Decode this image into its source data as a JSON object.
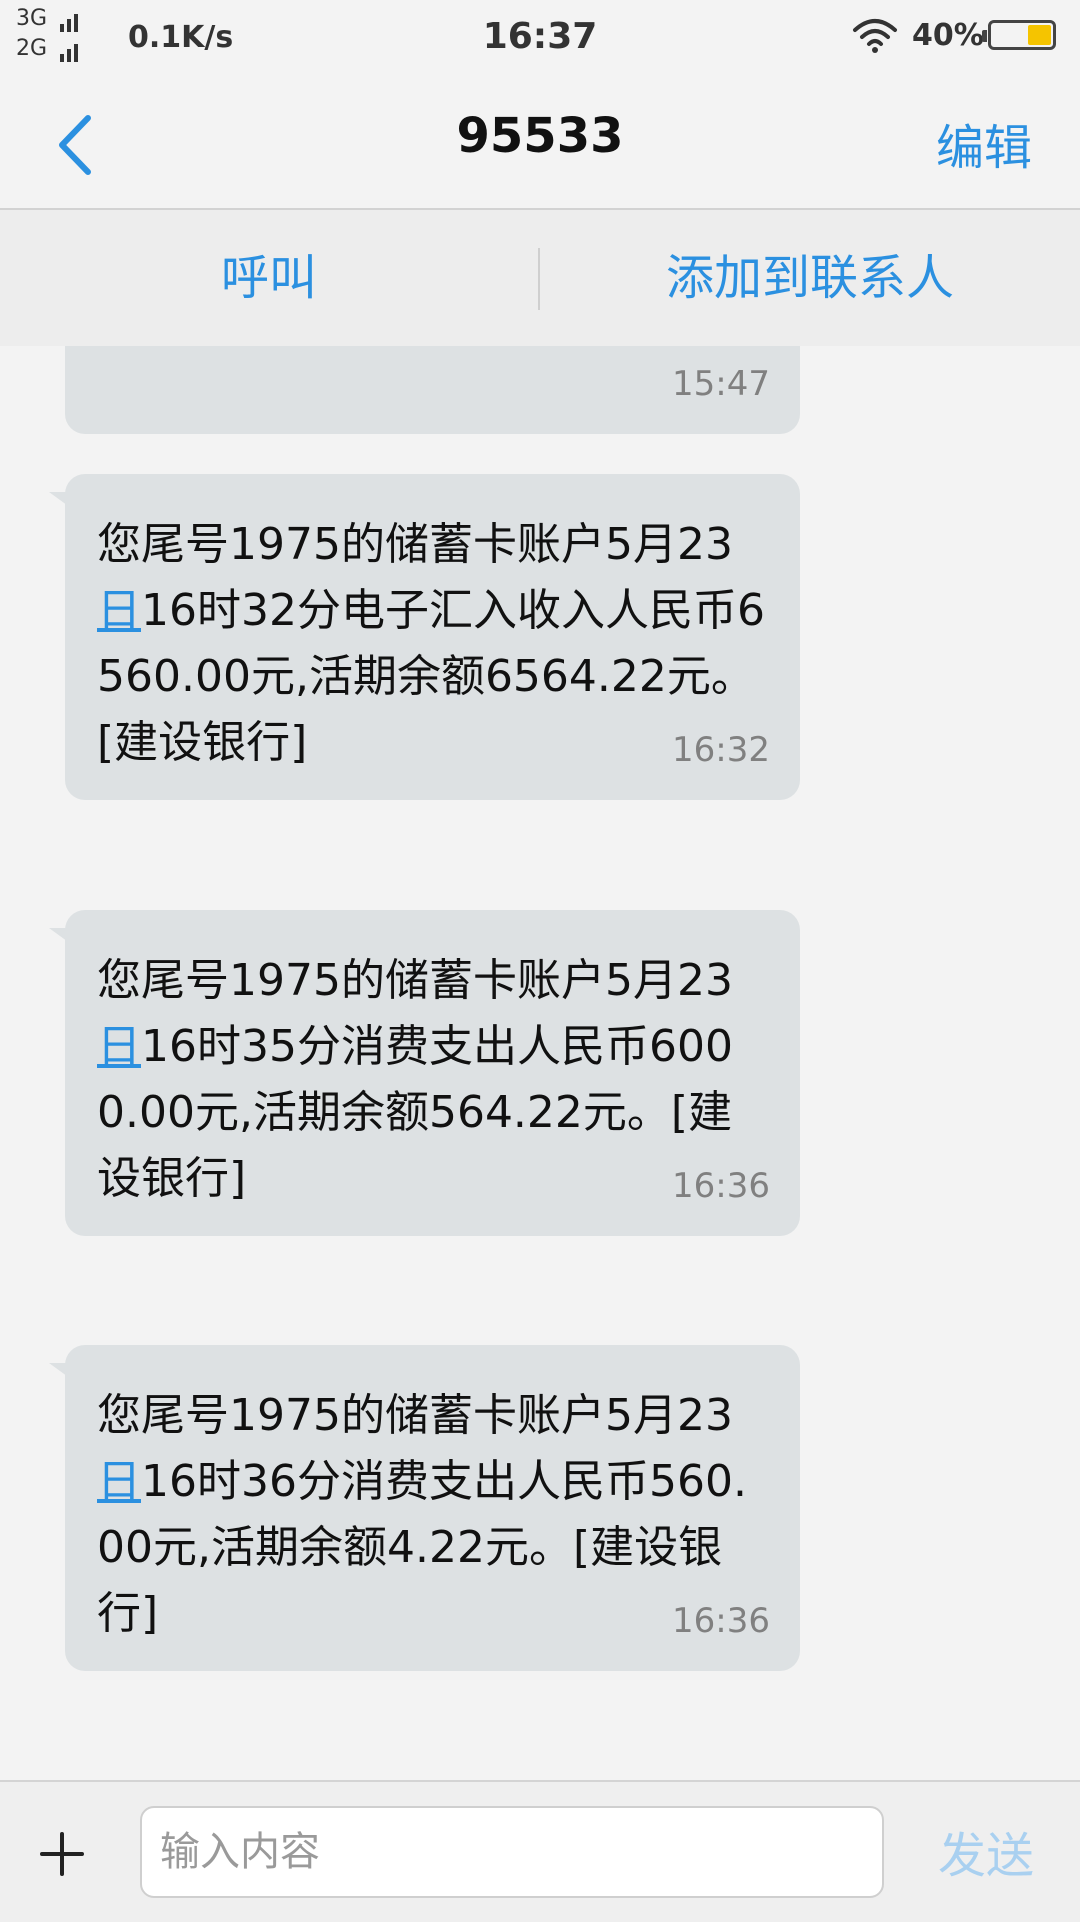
{
  "status_bar": {
    "network_top": "3G",
    "network_bottom": "2G",
    "speed": "0.1K/s",
    "time": "16:37",
    "battery_percent": "40%",
    "battery_level": 0.4,
    "battery_color": "#f5c400"
  },
  "nav": {
    "back_icon": "chevron-left-icon",
    "title": "95533",
    "edit_label": "编辑"
  },
  "actions": {
    "call_label": "呼叫",
    "add_contact_label": "添加到联系人"
  },
  "messages": [
    {
      "time": "15:47"
    },
    {
      "text_before": "您尾号1975的储蓄卡账户5月23",
      "link": "日",
      "text_after": "16时32分电子汇入收入人民币6560.00元,活期余额6564.22元。[建设银行]",
      "time": "16:32"
    },
    {
      "text_before": "您尾号1975的储蓄卡账户5月23",
      "link": "日",
      "text_after": "16时35分消费支出人民币6000.00元,活期余额564.22元。[建设银行]",
      "time": "16:36"
    },
    {
      "text_before": "您尾号1975的储蓄卡账户5月23",
      "link": "日",
      "text_after": "16时36分消费支出人民币560.00元,活期余额4.22元。[建设银行]",
      "time": "16:36"
    }
  ],
  "input": {
    "plus_icon": "plus-icon",
    "placeholder": "输入内容",
    "value": "",
    "send_label": "发送"
  },
  "colors": {
    "accent": "#2b90e0",
    "bubble": "#dde1e3",
    "send_disabled": "#a9d0f0"
  }
}
